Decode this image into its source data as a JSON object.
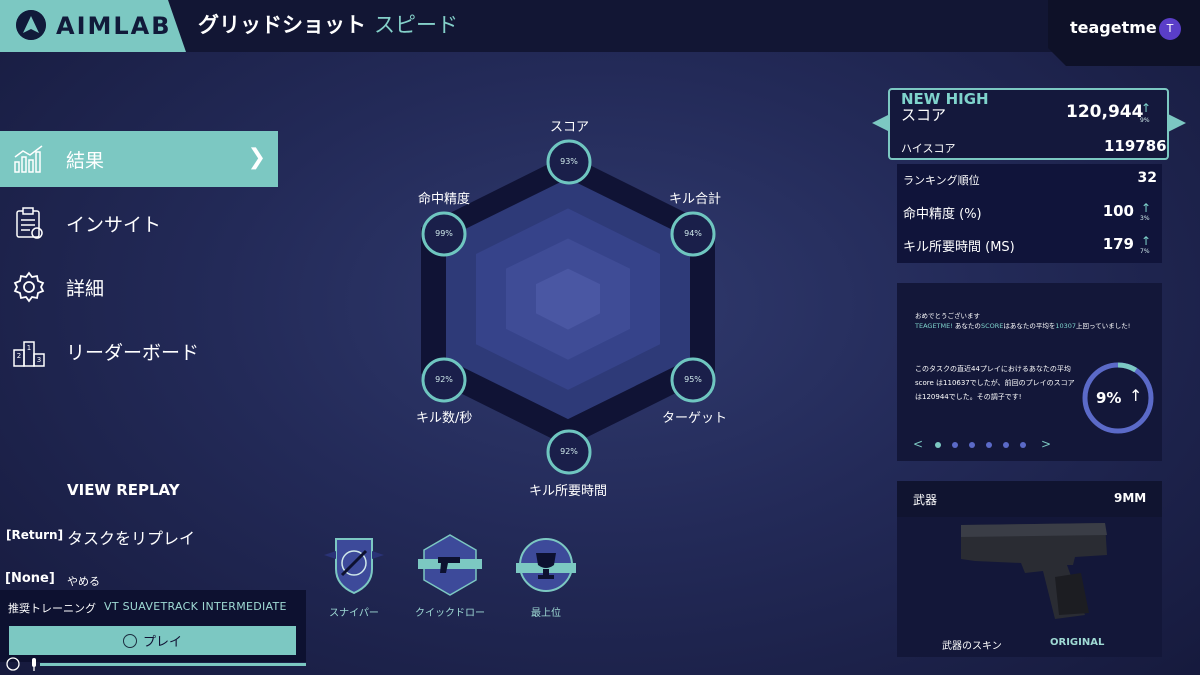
{
  "header": {
    "logo_text": "AIMLAB",
    "title_main": "グリッドショット",
    "title_sub": "スピード",
    "username": "teagetme",
    "avatar_initial": "T"
  },
  "sidebar": {
    "items": [
      {
        "label": "結果",
        "icon": "chart-icon",
        "active": true
      },
      {
        "label": "インサイト",
        "icon": "clipboard-icon",
        "active": false
      },
      {
        "label": "詳細",
        "icon": "gear-icon",
        "active": false
      },
      {
        "label": "リーダーボード",
        "icon": "podium-icon",
        "active": false
      }
    ]
  },
  "replay": {
    "title": "VIEW REPLAY",
    "key_return": "[Return]",
    "task_label": "タスクをリプレイ",
    "key_none": "[None]",
    "quit_label": "やめる"
  },
  "recommended": {
    "label": "推奨トレーニング",
    "name": "VT SUAVETRACK INTERMEDIATE",
    "play_label": "プレイ"
  },
  "radar": {
    "axes": [
      {
        "label": "スコア",
        "value": "93%"
      },
      {
        "label": "キル合計",
        "value": "94%"
      },
      {
        "label": "ターゲット",
        "value": "95%"
      },
      {
        "label": "キル所要時間",
        "value": "92%"
      },
      {
        "label": "キル数/秒",
        "value": "92%"
      },
      {
        "label": "命中精度",
        "value": "99%"
      }
    ]
  },
  "badges": [
    {
      "label": "スナイパー",
      "icon": "sniper-badge-icon"
    },
    {
      "label": "クイックドロー",
      "icon": "pistol-badge-icon"
    },
    {
      "label": "最上位",
      "icon": "trophy-badge-icon"
    }
  ],
  "score_panel": {
    "new_high": "NEW HIGH",
    "score_label": "スコア",
    "score_value": "120,944",
    "score_change": "9%",
    "high_label": "ハイスコア",
    "high_value": "119786"
  },
  "stats": {
    "ranking_label": "ランキング順位",
    "ranking_value": "32",
    "accuracy_label": "命中精度 (%)",
    "accuracy_value": "100",
    "accuracy_change": "3%",
    "ttk_label": "キル所要時間 (MS)",
    "ttk_value": "179",
    "ttk_change": "7%"
  },
  "congrats": {
    "line1": "おめでとうございます",
    "line2_name": "TEAGETME!",
    "line2_a": " あなたの",
    "line2_score": "SCORE",
    "line2_b": "はあなたの平均を",
    "line2_num": "10307",
    "line2_c": "上回っていました!",
    "paragraph": "このタスクの直近44プレイにおけるあなたの平均score は110637でしたが、前回のプレイのスコアは120944でした。その調子です!",
    "ring_value": "9%",
    "ring_fraction": 0.09,
    "carousel_dots": 6,
    "carousel_active": 0
  },
  "weapon": {
    "label": "武器",
    "value": "9MM",
    "skin_label": "武器のスキン",
    "skin_value": "ORIGINAL"
  },
  "colors": {
    "accent": "#7cc8c2",
    "bg": "#232a58",
    "panel": "#131739"
  }
}
